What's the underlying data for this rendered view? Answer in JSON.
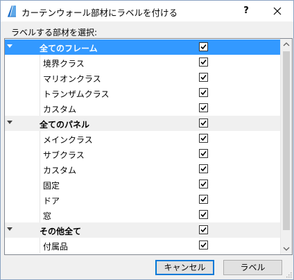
{
  "window": {
    "title": "カーテンウォール部材にラベルを付ける",
    "help_label": "?"
  },
  "prompt": "ラベルする部材を選択:",
  "rows": [
    {
      "type": "group",
      "label": "全てのフレーム",
      "checked": true,
      "selected": true
    },
    {
      "type": "item",
      "label": "境界クラス",
      "checked": true
    },
    {
      "type": "item",
      "label": "マリオンクラス",
      "checked": true
    },
    {
      "type": "item",
      "label": "トランザムクラス",
      "checked": true
    },
    {
      "type": "item",
      "label": "カスタム",
      "checked": true
    },
    {
      "type": "group",
      "label": "全てのパネル",
      "checked": true,
      "selected": false
    },
    {
      "type": "item",
      "label": "メインクラス",
      "checked": true
    },
    {
      "type": "item",
      "label": "サブクラス",
      "checked": true
    },
    {
      "type": "item",
      "label": "カスタム",
      "checked": true
    },
    {
      "type": "item",
      "label": "固定",
      "checked": true
    },
    {
      "type": "item",
      "label": "ドア",
      "checked": true
    },
    {
      "type": "item",
      "label": "窓",
      "checked": true
    },
    {
      "type": "group",
      "label": "その他全て",
      "checked": true,
      "selected": false
    },
    {
      "type": "item",
      "label": "付属品",
      "checked": true
    }
  ],
  "buttons": {
    "cancel_label": "キャンセル",
    "label_label": "ラベル"
  },
  "colors": {
    "selection": "#3399ff",
    "default_button_border": "#0078d7",
    "app_icon": "#1e6fc9"
  },
  "icons": {
    "app": "curtain-wall-icon",
    "close": "close-icon",
    "expand": "expand-arrow-icon",
    "checkbox": "checkbox-checked-icon"
  }
}
